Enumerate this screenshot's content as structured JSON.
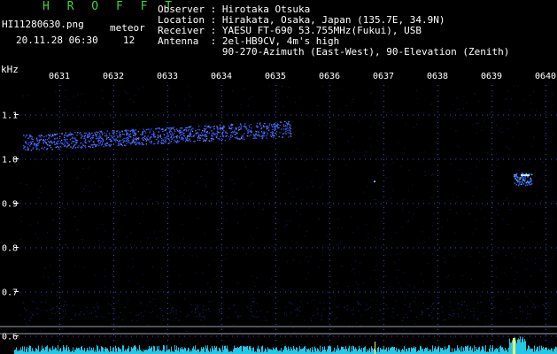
{
  "app": {
    "title": "H R O F F T",
    "filename": "HI11280630.png",
    "datetime": "20.11.28 06:30",
    "meteor_label": "meteor",
    "meteor_count": "12"
  },
  "info": {
    "observer": "Observer : Hirotaka Otsuka",
    "location": "Location : Hirakata, Osaka, Japan (135.7E, 34.9N)",
    "receiver": "Receiver : YAESU FT-690 53.755MHz(Fukui), USB",
    "antenna": "Antenna  : 2el-HB9CV, 4m's high",
    "antenna2": "           90-270-Azimuth (East-West), 90-Elevation (Zenith)"
  },
  "axes": {
    "y_unit": "kHz",
    "y_ticks": [
      "1.1",
      "1.0",
      "0.9",
      "0.8",
      "0.7",
      "0.6"
    ],
    "x_ticks": [
      "0631",
      "0632",
      "0633",
      "0634",
      "0635",
      "0636",
      "0637",
      "0638",
      "0639",
      "0640"
    ]
  },
  "colors": {
    "background": "#000000",
    "header_green": "#3fd23f",
    "signal_blue": "#3a5cff",
    "grid_dot": "#3a4cc8",
    "baseline_cyan": "#22c8e6",
    "ref_line": "#a0a0b0"
  }
}
